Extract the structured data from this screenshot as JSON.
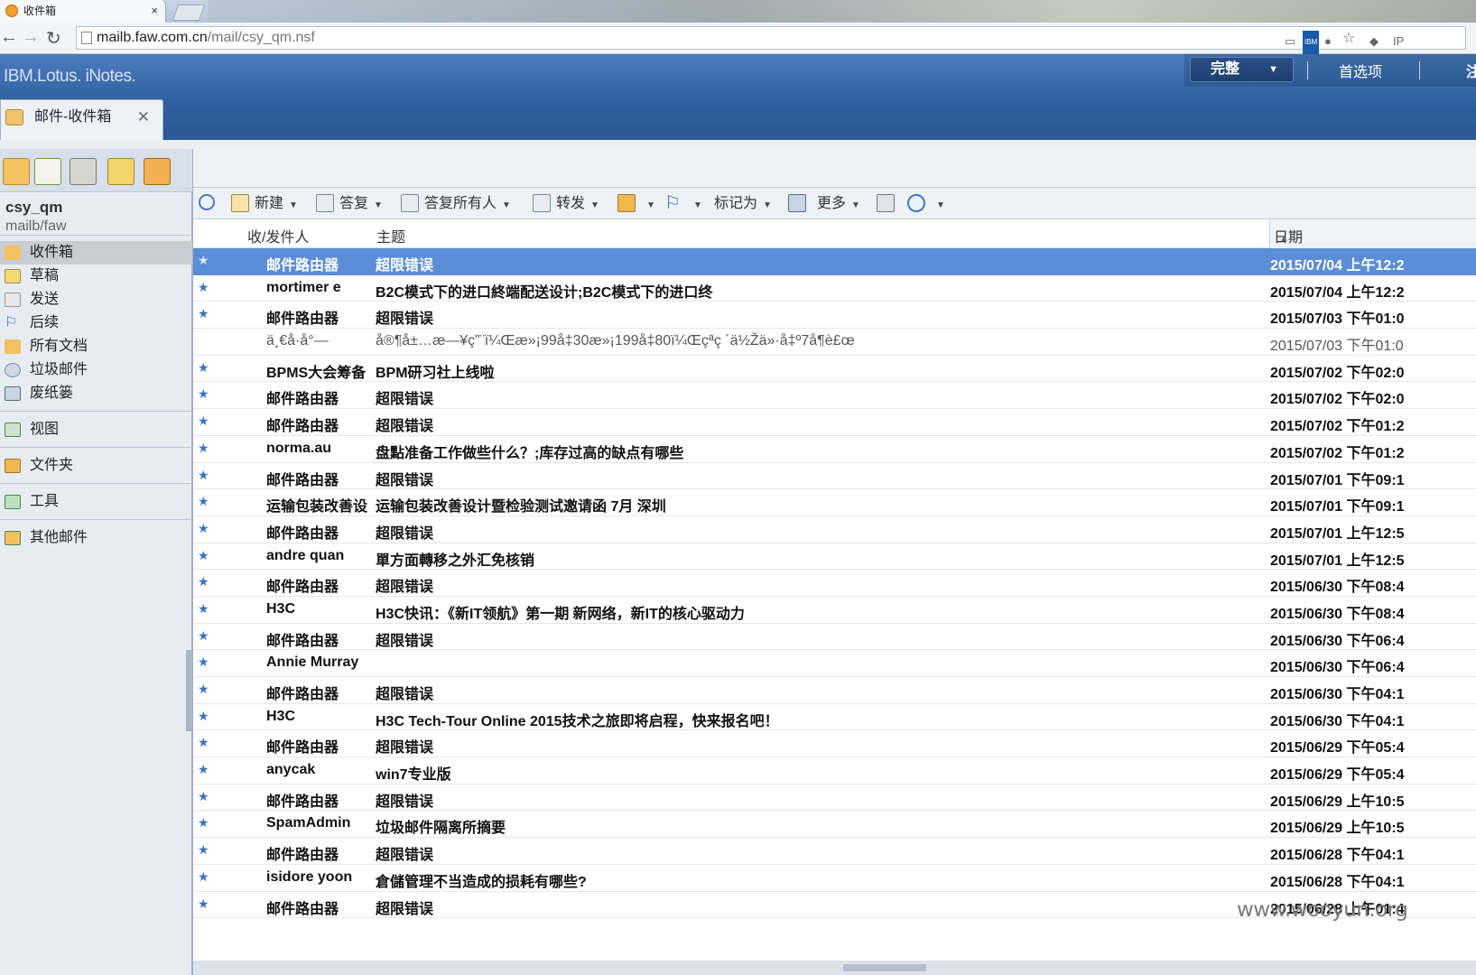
{
  "browser": {
    "tab_title": "收件箱",
    "url_host": "mailb.faw.com.cn",
    "url_path": "/mail/csy_qm.nsf"
  },
  "app": {
    "brand": "IBM.Lotus. iNotes.",
    "view_mode": "完整",
    "preferences": "首选项",
    "logout": "注",
    "tab_label": "邮件-收件箱"
  },
  "account": {
    "name": "csy_qm",
    "server": "mailb/faw"
  },
  "nav": {
    "items": [
      "收件箱",
      "草稿",
      "发送",
      "后续",
      "所有文档",
      "垃圾邮件",
      "废纸篓"
    ],
    "views": "视图",
    "folders": "文件夹",
    "tools": "工具",
    "other_mail": "其他邮件"
  },
  "toolbar": {
    "new": "新建",
    "reply": "答复",
    "reply_all": "答复所有人",
    "forward": "转发",
    "mark_as": "标记为",
    "more": "更多"
  },
  "columns": {
    "from": "收/发件人",
    "subject": "主题",
    "date": "日期"
  },
  "messages": [
    {
      "from": "邮件路由器",
      "subject": "超限错误",
      "date": "2015/07/04 上午12:2"
    },
    {
      "from": "mortimer e",
      "subject": "B2C模式下的进口終端配送设计;B2C模式下的进口终",
      "date": "2015/07/04 上午12:2"
    },
    {
      "from": "邮件路由器",
      "subject": "超限错误",
      "date": "2015/07/03 下午01:0"
    },
    {
      "from": "ä¸€å·å°—",
      "subject": "å®¶å±…æ—¥ç”¨ï¼Œæ»¡99å‡30æ»¡199å‡80ï¼Œçªç ´ä½Žä»·å‡º7å¶è£œ",
      "date": "2015/07/03 下午01:0"
    },
    {
      "from": "BPMS大会筹备",
      "subject": "BPM研习社上线啦",
      "date": "2015/07/02 下午02:0"
    },
    {
      "from": "邮件路由器",
      "subject": "超限错误",
      "date": "2015/07/02 下午02:0"
    },
    {
      "from": "邮件路由器",
      "subject": "超限错误",
      "date": "2015/07/02 下午01:2"
    },
    {
      "from": "norma.au",
      "subject": "盘點准备工作做些什么？;库存过高的缺点有哪些",
      "date": "2015/07/02 下午01:2"
    },
    {
      "from": "邮件路由器",
      "subject": "超限错误",
      "date": "2015/07/01 下午09:1"
    },
    {
      "from": "运输包装改善设",
      "subject": "运输包装改善设计暨检验测试邀请函  7月 深圳",
      "date": "2015/07/01 下午09:1"
    },
    {
      "from": "邮件路由器",
      "subject": "超限错误",
      "date": "2015/07/01 上午12:5"
    },
    {
      "from": "andre quan",
      "subject": "單方面轉移之外汇免核销",
      "date": "2015/07/01 上午12:5"
    },
    {
      "from": "邮件路由器",
      "subject": "超限错误",
      "date": "2015/06/30 下午08:4"
    },
    {
      "from": "H3C",
      "subject": "H3C快讯：《新IT领航》第一期 新网络，新IT的核心驱动力",
      "date": "2015/06/30 下午08:4"
    },
    {
      "from": "邮件路由器",
      "subject": "超限错误",
      "date": "2015/06/30 下午06:4"
    },
    {
      "from": "Annie Murray",
      "subject": "",
      "date": "2015/06/30 下午06:4"
    },
    {
      "from": "邮件路由器",
      "subject": "超限错误",
      "date": "2015/06/30 下午04:1"
    },
    {
      "from": "H3C",
      "subject": "H3C Tech-Tour Online 2015技术之旅即将启程，快来报名吧！",
      "date": "2015/06/30 下午04:1"
    },
    {
      "from": "邮件路由器",
      "subject": "超限错误",
      "date": "2015/06/29 下午05:4"
    },
    {
      "from": "anycak",
      "subject": "win7专业版",
      "date": "2015/06/29 下午05:4"
    },
    {
      "from": "邮件路由器",
      "subject": "超限错误",
      "date": "2015/06/29 上午10:5"
    },
    {
      "from": "SpamAdmin",
      "subject": "垃圾邮件隔离所摘要",
      "date": "2015/06/29 上午10:5"
    },
    {
      "from": "邮件路由器",
      "subject": "超限错误",
      "date": "2015/06/28 下午04:1"
    },
    {
      "from": "isidore yoon",
      "subject": "倉儲管理不当造成的损耗有哪些?",
      "date": "2015/06/28 下午04:1"
    },
    {
      "from": "邮件路由器",
      "subject": "超限错误",
      "date": "2015/06/28 上午01:4"
    }
  ],
  "watermark": "www.wooyun.org"
}
